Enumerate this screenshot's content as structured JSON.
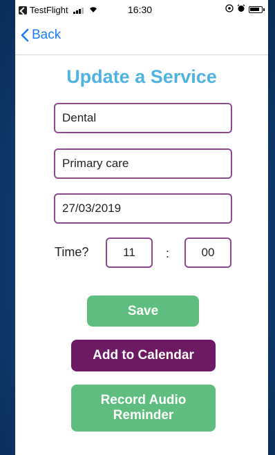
{
  "status_bar": {
    "app": "TestFlight",
    "time": "16:30"
  },
  "nav": {
    "back_label": "Back"
  },
  "page": {
    "title": "Update a Service"
  },
  "form": {
    "service_type": "Dental",
    "service_category": "Primary care",
    "date": "27/03/2019",
    "time_label": "Time?",
    "hour": "11",
    "separator": ":",
    "minute": "00"
  },
  "buttons": {
    "save": "Save",
    "add_to_calendar": "Add to Calendar",
    "record_audio_reminder": "Record Audio Reminder"
  },
  "colors": {
    "accent_title": "#4fb2e0",
    "field_border": "#8b4a8e",
    "green_button": "#5fbe7f",
    "purple_button": "#6e1a63",
    "ios_link": "#1a7cf5"
  }
}
